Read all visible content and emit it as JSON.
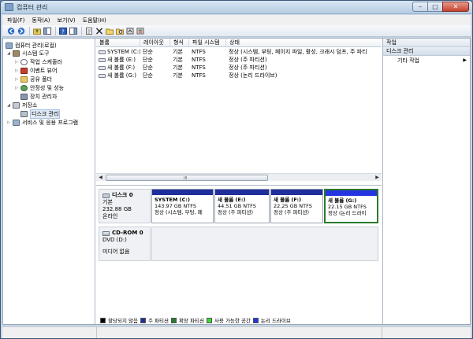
{
  "window": {
    "title": "컴퓨터 관리"
  },
  "title_buttons": {
    "minimize": "–",
    "maximize": "□",
    "close": "✕"
  },
  "menu": [
    "파일(F)",
    "동작(A)",
    "보기(V)",
    "도움말(H)"
  ],
  "toolbar_icons": [
    "back-icon",
    "forward-icon",
    "up-folder-icon",
    "show-hide-tree-icon",
    "help-icon",
    "show-hide-action-icon",
    "properties-icon",
    "delete-icon",
    "open-icon",
    "explore-icon",
    "refresh-icon",
    "settings-icon"
  ],
  "tree": {
    "root": "컴퓨터 관리(로컬)",
    "items": [
      {
        "label": "시스템 도구",
        "level": 1,
        "expanded": true
      },
      {
        "label": "작업 스케줄러",
        "level": 2
      },
      {
        "label": "이벤트 뷰어",
        "level": 2
      },
      {
        "label": "공유 폴더",
        "level": 2
      },
      {
        "label": "안정성 및 성능",
        "level": 2
      },
      {
        "label": "장치 관리자",
        "level": 2
      },
      {
        "label": "저장소",
        "level": 1,
        "expanded": true
      },
      {
        "label": "디스크 관리",
        "level": 2,
        "selected": true
      },
      {
        "label": "서비스 및 응용 프로그램",
        "level": 1
      }
    ]
  },
  "volume_list": {
    "columns": [
      "볼륨",
      "레이아웃",
      "형식",
      "파일 시스템",
      "상태"
    ],
    "rows": [
      [
        "SYSTEM (C:)",
        "단순",
        "기본",
        "NTFS",
        "정상 (시스템, 부팅, 페이지 파일, 활성, 크래시 덤프, 주 파티"
      ],
      [
        "새 볼륨 (E:)",
        "단순",
        "기본",
        "NTFS",
        "정상 (주 파티션)"
      ],
      [
        "새 볼륨 (F:)",
        "단순",
        "기본",
        "NTFS",
        "정상 (주 파티션)"
      ],
      [
        "새 볼륨 (G:)",
        "단순",
        "기본",
        "NTFS",
        "정상 (논리 드라이브)"
      ]
    ]
  },
  "disks": [
    {
      "name": "디스크 0",
      "type": "기본",
      "size": "232.88 GB",
      "status": "온라인",
      "partitions": [
        {
          "name": "SYSTEM (C:)",
          "size": "143.97 GB NTFS",
          "status": "정상 (시스템, 부팅, 페",
          "selected": false
        },
        {
          "name": "새 볼륨 (E:)",
          "size": "44.51 GB NTFS",
          "status": "정상 (주 파티션)",
          "selected": false
        },
        {
          "name": "새 볼륨 (F:)",
          "size": "22.25 GB NTFS",
          "status": "정상 (주 파티션)",
          "selected": false
        },
        {
          "name": "새 볼륨 (G:)",
          "size": "22.15 GB NTFS",
          "status": "정상 (논리 드라이",
          "selected": true
        }
      ]
    },
    {
      "name": "CD-ROM 0",
      "type": "DVD (D:)",
      "status": "미디어 없음"
    }
  ],
  "legend": [
    {
      "label": "할당되지 않음",
      "color": "#000000"
    },
    {
      "label": "주 파티션",
      "color": "#1f2f9c"
    },
    {
      "label": "확장 파티션",
      "color": "#2b7a2b"
    },
    {
      "label": "사용 가능한 공간",
      "color": "#33dd33"
    },
    {
      "label": "논리 드라이브",
      "color": "#2434e0"
    }
  ],
  "actions": {
    "header": "작업",
    "section": "디스크 관리",
    "items": [
      {
        "label": "기타 작업",
        "arrow": "▶"
      }
    ]
  },
  "scroll_grip": "III"
}
